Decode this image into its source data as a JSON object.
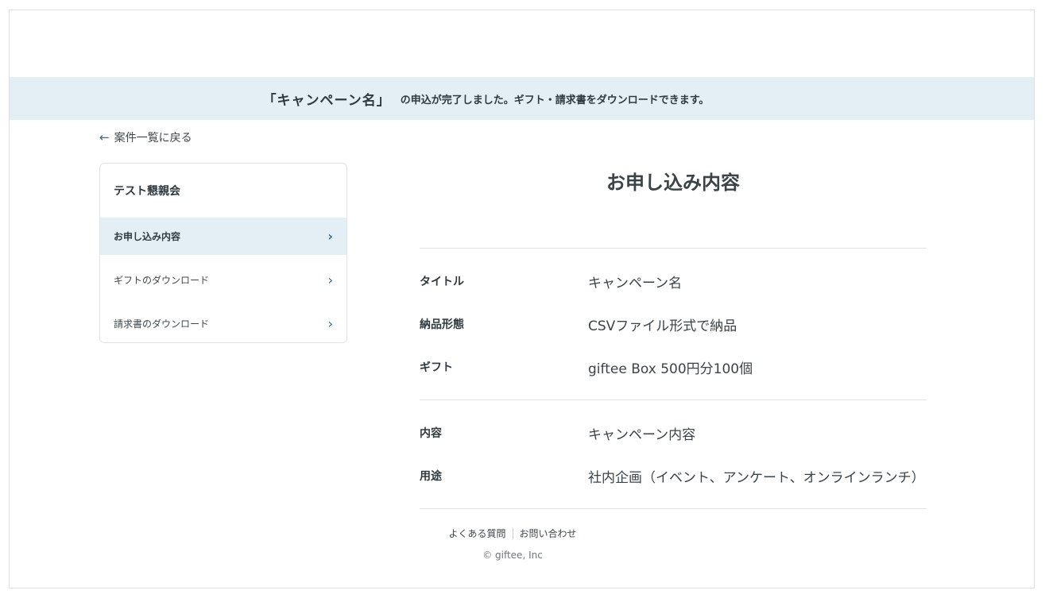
{
  "banner": {
    "campaign_name": "「キャンペーン名」",
    "message": "の申込が完了しました。ギフト・請求書をダウンロードできます。"
  },
  "back_link": {
    "arrow": "←",
    "label": "案件一覧に戻る"
  },
  "sidebar": {
    "title": "テスト懇親会",
    "chevron": "›",
    "items": [
      {
        "label": "お申し込み内容"
      },
      {
        "label": "ギフトのダウンロード"
      },
      {
        "label": "請求書のダウンロード"
      }
    ]
  },
  "main": {
    "title": "お申し込み内容",
    "group1": [
      {
        "label": "タイトル",
        "value": "キャンペーン名"
      },
      {
        "label": "納品形態",
        "value": "CSVファイル形式で納品"
      },
      {
        "label": "ギフト",
        "value": "giftee Box 500円分100個"
      }
    ],
    "group2": [
      {
        "label": "内容",
        "value": "キャンペーン内容"
      },
      {
        "label": "用途",
        "value": "社内企画（イベント、アンケート、オンラインランチ）"
      }
    ]
  },
  "footer": {
    "faq": "よくある質問",
    "contact": "お問い合わせ",
    "copyright": "© giftee, Inc"
  },
  "colors": {
    "accent": "#2f6f93",
    "banner_bg": "#e3eff5"
  }
}
